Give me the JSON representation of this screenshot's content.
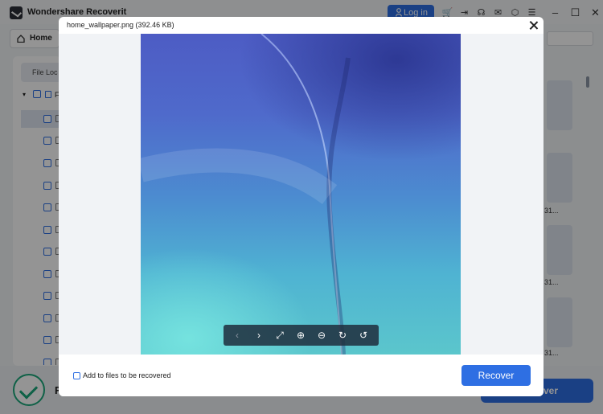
{
  "app": {
    "title": "Wondershare Recoverit",
    "login_label": "Log in",
    "home_label": "Home",
    "file_location_label": "File Loc",
    "tree_root_label": "F",
    "bottom_letter": "F",
    "background_recover_label": "ver",
    "thumb_labels": [
      "31...",
      "31...",
      "31..."
    ],
    "toolbar_icons": [
      "cart-icon",
      "export-icon",
      "headset-icon",
      "mail-icon",
      "settings-icon",
      "menu-icon"
    ],
    "window_controls": [
      "minimize-icon",
      "maximize-icon",
      "close-icon"
    ]
  },
  "preview_dialog": {
    "file_title": "home_wallpaper.png (392.46 KB)",
    "add_to_recover_label": "Add to files to be recovered",
    "add_to_recover_checked": false,
    "recover_label": "Recover",
    "tools": [
      {
        "name": "previous-icon",
        "enabled": false
      },
      {
        "name": "next-icon",
        "enabled": true
      },
      {
        "name": "fullscreen-icon",
        "enabled": true
      },
      {
        "name": "zoom-in-icon",
        "enabled": true
      },
      {
        "name": "zoom-out-icon",
        "enabled": true
      },
      {
        "name": "rotate-right-icon",
        "enabled": true
      },
      {
        "name": "rotate-left-icon",
        "enabled": true
      }
    ]
  },
  "colors": {
    "accent": "#2e6fe3",
    "success": "#1aa87a"
  }
}
